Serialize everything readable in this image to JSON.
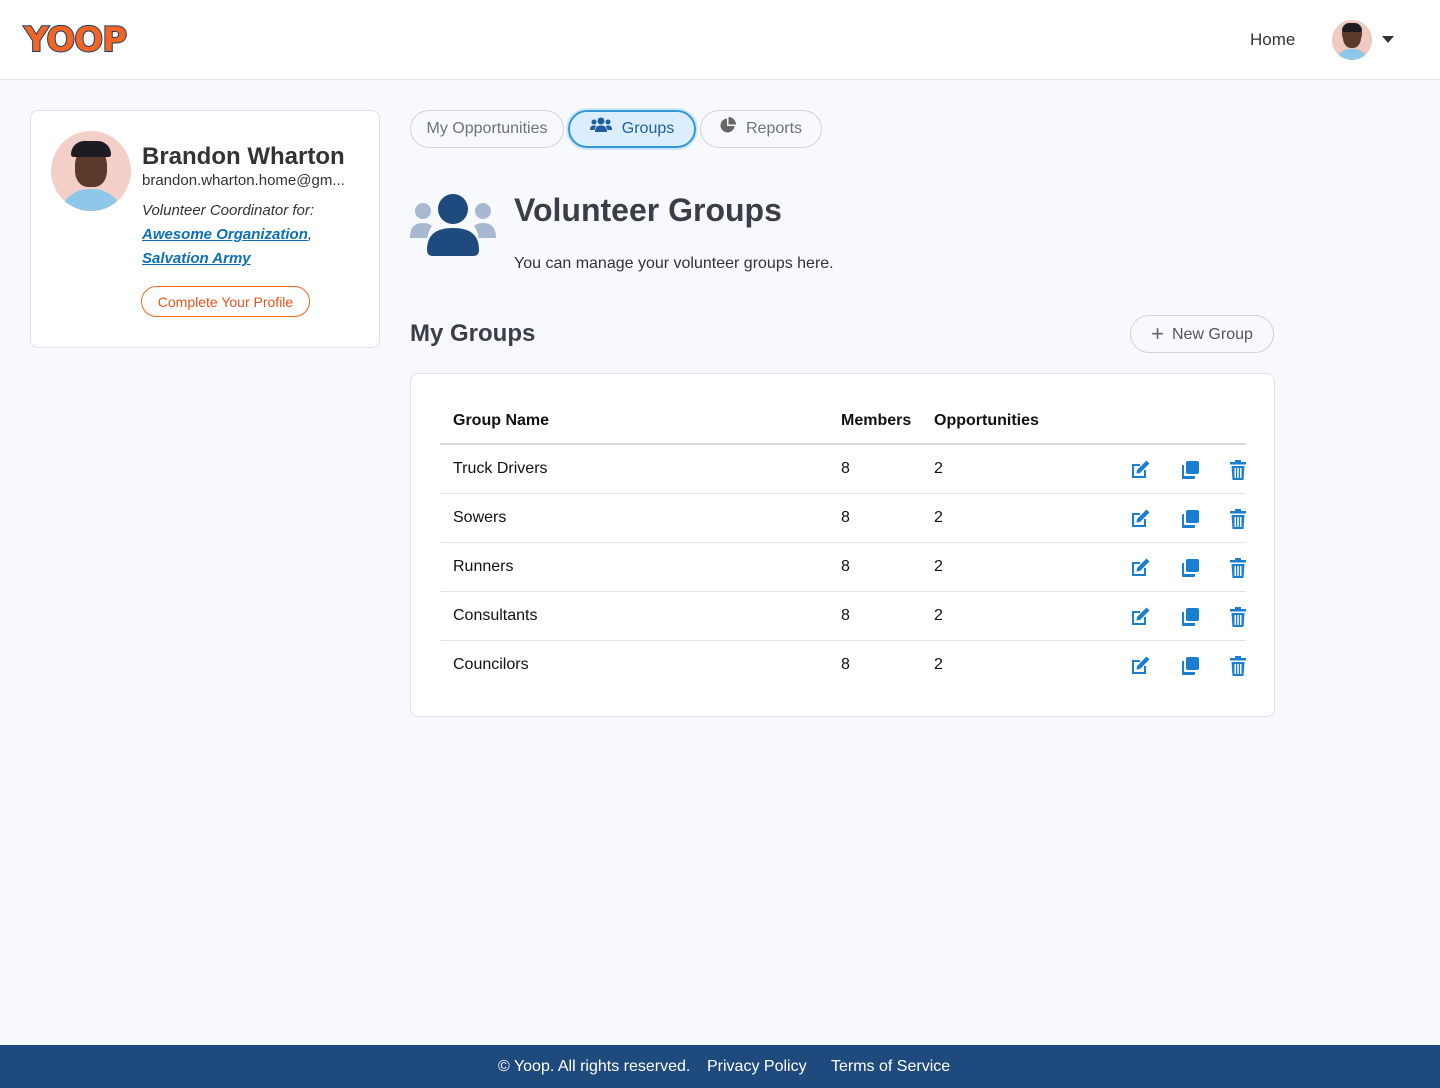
{
  "header": {
    "logo_text": "YOOP",
    "nav_home": "Home"
  },
  "profile": {
    "name": "Brandon Wharton",
    "email": "brandon.wharton.home@gm...",
    "role_text": "Volunteer Coordinator for:",
    "organizations": [
      "Awesome Organization",
      "Salvation Army"
    ],
    "org_separator": ",",
    "complete_button": "Complete Your Profile"
  },
  "tabs": [
    {
      "label": "My Opportunities",
      "active": false
    },
    {
      "label": "Groups",
      "active": true,
      "icon": "users-icon"
    },
    {
      "label": "Reports",
      "active": false,
      "icon": "pie-chart-icon"
    }
  ],
  "hero": {
    "title": "Volunteer Groups",
    "subtitle": "You can manage your volunteer groups here."
  },
  "groups": {
    "section_title": "My Groups",
    "new_button": "New Group",
    "columns": [
      "Group Name",
      "Members",
      "Opportunities"
    ],
    "rows": [
      {
        "name": "Truck Drivers",
        "members": "8",
        "opportunities": "2"
      },
      {
        "name": "Sowers",
        "members": "8",
        "opportunities": "2"
      },
      {
        "name": "Runners",
        "members": "8",
        "opportunities": "2"
      },
      {
        "name": "Consultants",
        "members": "8",
        "opportunities": "2"
      },
      {
        "name": "Councilors",
        "members": "8",
        "opportunities": "2"
      }
    ],
    "row_actions": [
      "edit-icon",
      "copy-icon",
      "trash-icon"
    ]
  },
  "footer": {
    "copyright": "© Yoop. All rights reserved.",
    "privacy": "Privacy Policy",
    "terms": "Terms of Service"
  },
  "colors": {
    "accent_orange": "#f26522",
    "link_blue": "#0d6fb8",
    "action_blue": "#1a7fd0",
    "footer_navy": "#1f4a7e",
    "hero_icon_dark": "#1f4a7e",
    "hero_icon_light": "#a8b8d0"
  }
}
